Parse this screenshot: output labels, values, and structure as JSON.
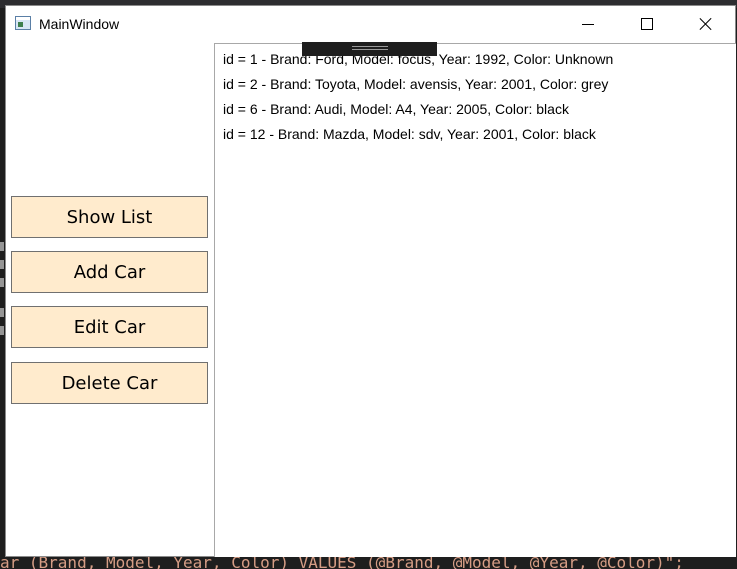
{
  "window": {
    "title": "MainWindow"
  },
  "buttons": {
    "show_list": "Show List",
    "add_car": "Add Car",
    "edit_car": "Edit Car",
    "delete_car": "Delete Car"
  },
  "list": {
    "items": [
      "id = 1 - Brand: Ford, Model: focus, Year: 1992, Color: Unknown",
      "id = 2 - Brand: Toyota, Model: avensis, Year: 2001, Color: grey",
      "id = 6 - Brand: Audi, Model: A4, Year: 2005, Color: black",
      "id = 12 - Brand: Mazda, Model: sdv, Year: 2001, Color: black"
    ]
  },
  "background": {
    "code_line": "ar (Brand, Model, Year, Color) VALUES (@Brand, @Model, @Year, @Color)\";"
  },
  "colors": {
    "button_background": "#ffebcd",
    "window_background": "#ffffff",
    "ide_background": "#1e1e1e"
  },
  "icons": {
    "app": "app-window-icon",
    "minimize": "minimize-icon",
    "maximize": "maximize-icon",
    "close": "close-icon"
  }
}
